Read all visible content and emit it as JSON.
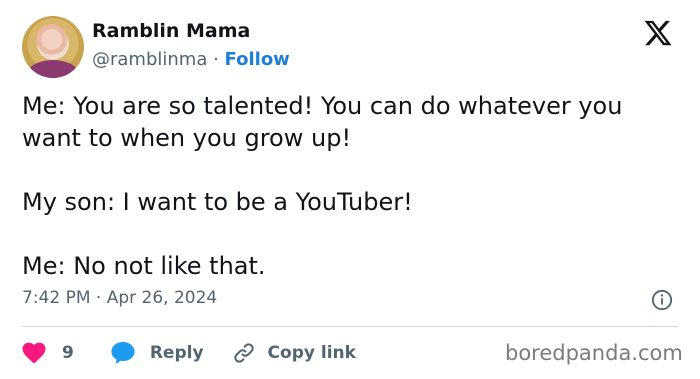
{
  "author": {
    "display_name": "Ramblin Mama",
    "handle": "@ramblinma",
    "separator": " · ",
    "follow_label": "Follow"
  },
  "tweet": {
    "lines": [
      "Me: You are so talented! You can do whatever you want to when you grow up!",
      "My son: I want to be a YouTuber!",
      "Me: No not like that."
    ],
    "timestamp": "7:42 PM · Apr 26, 2024"
  },
  "actions": {
    "like_count": "9",
    "reply_label": "Reply",
    "copy_link_label": "Copy link"
  },
  "watermark": "boredpanda.com",
  "colors": {
    "like": "#f91880",
    "reply": "#1d9bf0",
    "follow": "#1d7fd8",
    "muted": "#536471",
    "text": "#0f1419"
  },
  "icons": [
    "x-logo-icon",
    "info-icon",
    "heart-icon",
    "reply-bubble-icon",
    "link-icon"
  ]
}
